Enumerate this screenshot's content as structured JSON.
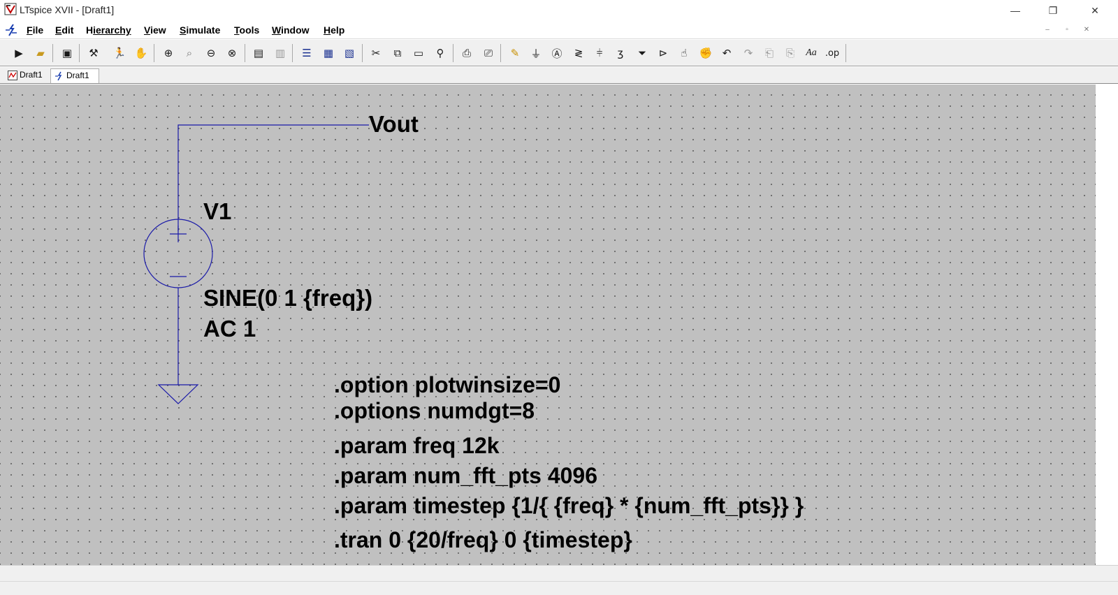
{
  "window": {
    "title": "LTspice XVII - [Draft1]",
    "controls": {
      "minimize": "—",
      "maximize": "❐",
      "close": "✕"
    }
  },
  "menu": {
    "items": [
      {
        "label": "File",
        "accel": "F",
        "rest": "ile"
      },
      {
        "label": "Edit",
        "accel": "E",
        "rest": "dit"
      },
      {
        "label": "Hierarchy",
        "accel": "H",
        "pre": "",
        "rest": "ierarchy"
      },
      {
        "label": "View",
        "accel": "V",
        "rest": "iew"
      },
      {
        "label": "Simulate",
        "accel": "S",
        "rest": "imulate"
      },
      {
        "label": "Tools",
        "accel": "T",
        "rest": "ools"
      },
      {
        "label": "Window",
        "accel": "W",
        "rest": "indow"
      },
      {
        "label": "Help",
        "accel": "H",
        "rest": "elp"
      }
    ],
    "mdi_controls": {
      "minimize": "–",
      "restore": "▫",
      "close": "✕"
    }
  },
  "toolbar": {
    "icons": [
      "run-icon",
      "open-icon",
      "save-icon",
      "control-panel-icon",
      "halt-icon",
      "pan-hand-icon",
      "zoom-in-icon",
      "zoom-area-icon",
      "zoom-out-icon",
      "zoom-fit-icon",
      "autoscale-icon",
      "waveform-icon",
      "tile-horizontal-icon",
      "cascade-icon",
      "tile-vertical-icon",
      "cut-icon",
      "copy-icon",
      "paste-icon",
      "find-icon",
      "print-icon",
      "print-setup-icon",
      "wire-icon",
      "ground-icon",
      "label-net-icon",
      "resistor-icon",
      "capacitor-icon",
      "inductor-icon",
      "diode-icon",
      "component-icon",
      "move-icon",
      "drag-icon",
      "undo-icon",
      "redo-icon",
      "rotate-icon",
      "mirror-icon",
      "text-icon",
      "spice-directive-icon"
    ],
    "text_glyphs": {
      "text": "Aa",
      "directive": ".op"
    }
  },
  "tabs": [
    {
      "label": "Draft1",
      "kind": "waveform"
    },
    {
      "label": "Draft1",
      "kind": "schematic",
      "active": true
    }
  ],
  "schematic": {
    "net_label": "Vout",
    "source": {
      "name": "V1",
      "value": "SINE(0 1 {freq})",
      "ac": "AC 1"
    },
    "directives": [
      ".option plotwinsize=0",
      ".options numdgt=8",
      ".param freq 12k",
      ".param num_fft_pts 4096",
      ".param timestep {1/{ {freq} * {num_fft_pts}} }",
      ".tran 0 {20/freq} 0 {timestep}"
    ]
  },
  "colors": {
    "canvas": "#c0c0c0",
    "wire": "#1a1aa8",
    "grid_dot": "#5a5a5a",
    "text": "#000000"
  }
}
